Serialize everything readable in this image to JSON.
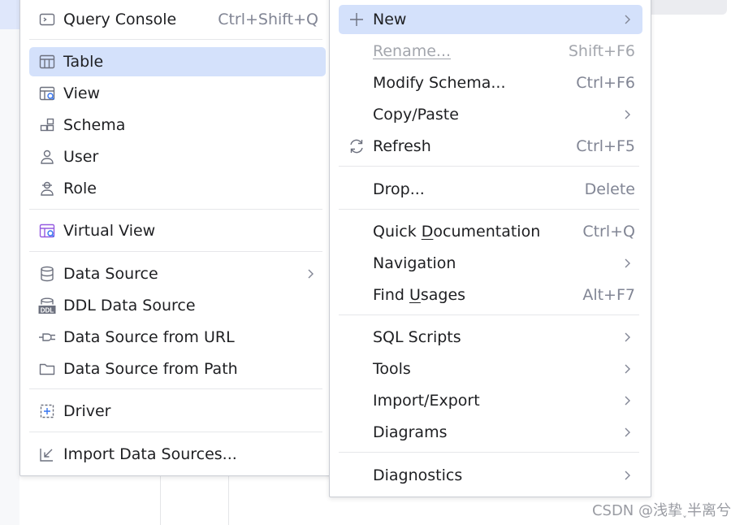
{
  "left_menu": {
    "items": [
      {
        "label": "Query Console",
        "shortcut": "Ctrl+Shift+Q"
      },
      {
        "label": "Table"
      },
      {
        "label": "View"
      },
      {
        "label": "Schema"
      },
      {
        "label": "User"
      },
      {
        "label": "Role"
      },
      {
        "label": "Virtual View"
      },
      {
        "label": "Data Source"
      },
      {
        "label": "DDL Data Source"
      },
      {
        "label": "Data Source from URL"
      },
      {
        "label": "Data Source from Path"
      },
      {
        "label": "Driver"
      },
      {
        "label": "Import Data Sources..."
      }
    ],
    "ddl_icon_text": "DDL"
  },
  "right_menu": {
    "new_label": "New",
    "rename": {
      "label": "Rename...",
      "shortcut": "Shift+F6"
    },
    "modify_schema": {
      "label": "Modify Schema...",
      "shortcut": "Ctrl+F6"
    },
    "copy_paste": {
      "label": "Copy/Paste"
    },
    "refresh": {
      "label": "Refresh",
      "shortcut": "Ctrl+F5"
    },
    "drop": {
      "label": "Drop...",
      "shortcut": "Delete"
    },
    "quick_doc": {
      "pre": "Quick ",
      "ul": "D",
      "post": "ocumentation",
      "shortcut": "Ctrl+Q"
    },
    "navigation": {
      "label": "Navigation"
    },
    "find_usages": {
      "pre": "Find ",
      "ul": "U",
      "post": "sages",
      "shortcut": "Alt+F7"
    },
    "sql_scripts": {
      "label": "SQL Scripts"
    },
    "tools": {
      "label": "Tools"
    },
    "import_export": {
      "label": "Import/Export"
    },
    "diagrams": {
      "label": "Diagrams"
    },
    "diagnostics": {
      "label": "Diagnostics"
    }
  },
  "colors": {
    "selection": "#d4e1fb",
    "icon": "#6c707e",
    "accent": "#3574f0",
    "violet": "#955ae0"
  },
  "watermark": "CSDN @浅挚˯半离兮"
}
